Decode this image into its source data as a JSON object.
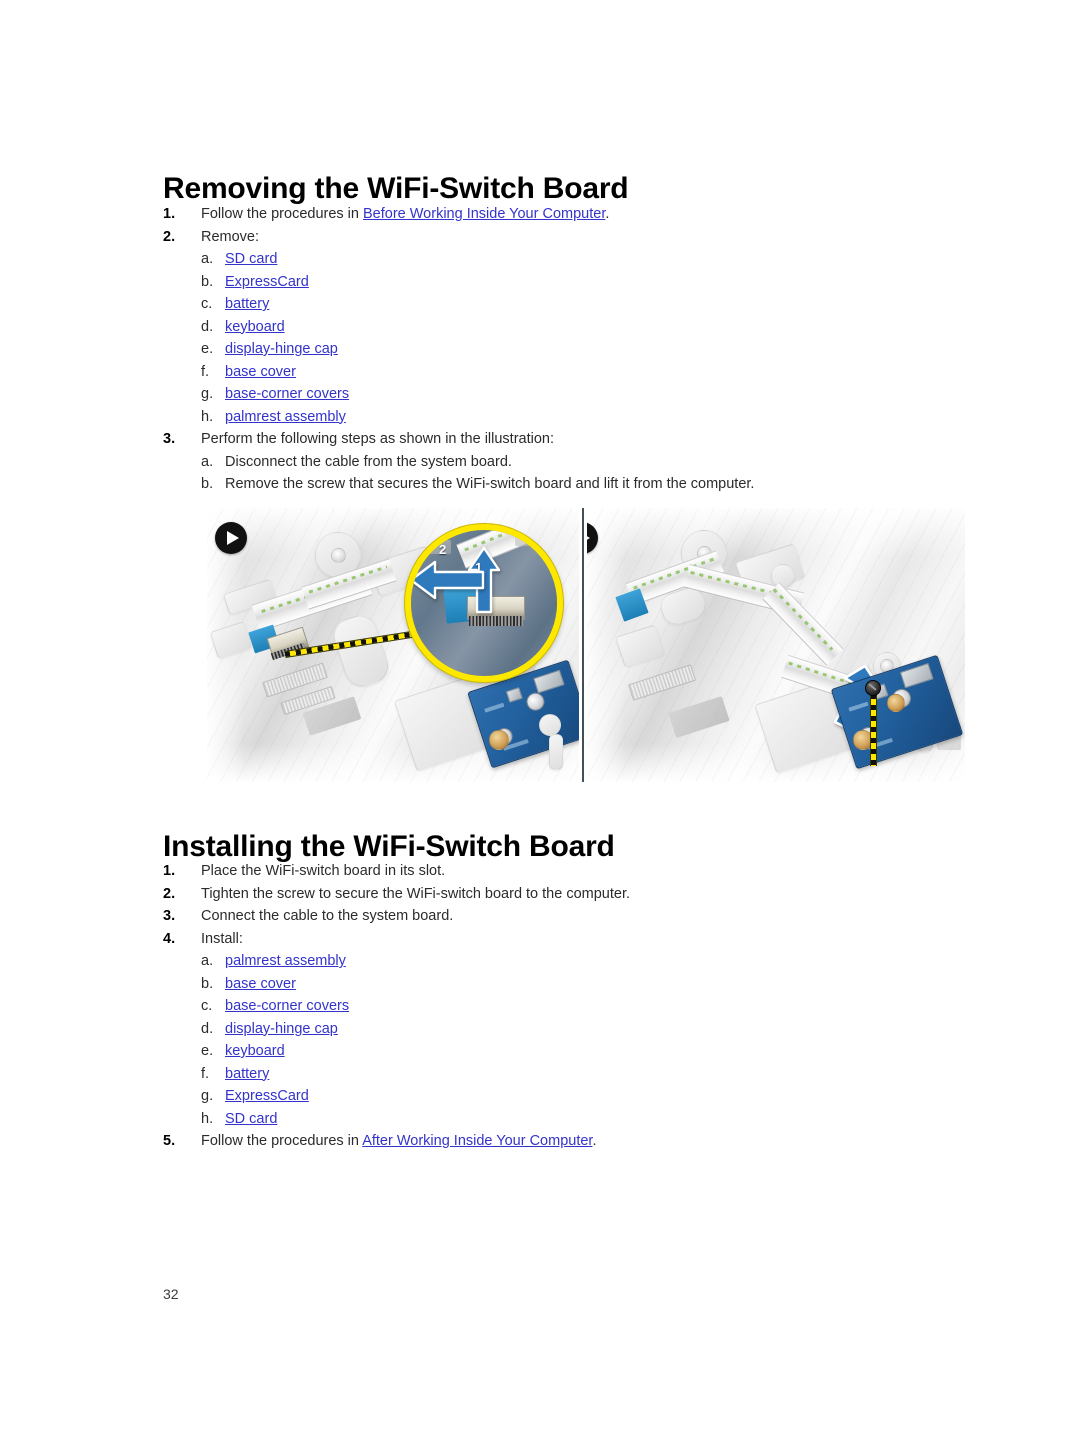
{
  "document": {
    "page_number": "32"
  },
  "removing": {
    "heading": "Removing the WiFi-Switch Board",
    "steps": [
      {
        "marker": "1.",
        "text_before": "Follow the procedures in ",
        "link": "Before Working Inside Your Computer",
        "text_after": "."
      },
      {
        "marker": "2.",
        "text": "Remove:"
      },
      {
        "marker": "3.",
        "text": "Perform the following steps as shown in the illustration:"
      }
    ],
    "remove_items": [
      {
        "marker": "a.",
        "label": "SD card",
        "is_link": true
      },
      {
        "marker": "b.",
        "label": "ExpressCard",
        "is_link": true
      },
      {
        "marker": "c.",
        "label": "battery",
        "is_link": true
      },
      {
        "marker": "d.",
        "label": "keyboard",
        "is_link": true
      },
      {
        "marker": "e.",
        "label": "display-hinge cap",
        "is_link": true
      },
      {
        "marker": "f.",
        "label": "base cover",
        "is_link": true
      },
      {
        "marker": "g.",
        "label": "base-corner covers",
        "is_link": true
      },
      {
        "marker": "h.",
        "label": "palmrest assembly",
        "is_link": true
      }
    ],
    "illustration_steps": [
      {
        "marker": "a.",
        "label": "Disconnect the cable from the system board.",
        "is_link": false
      },
      {
        "marker": "b.",
        "label": "Remove the screw that secures the WiFi-switch board and lift it from the computer.",
        "is_link": false
      }
    ]
  },
  "installing": {
    "heading": "Installing the WiFi-Switch Board",
    "steps": [
      {
        "marker": "1.",
        "text": "Place the WiFi-switch board in its slot."
      },
      {
        "marker": "2.",
        "text": "Tighten the screw to secure the WiFi-switch board to the computer."
      },
      {
        "marker": "3.",
        "text": "Connect the cable to the system board."
      },
      {
        "marker": "4.",
        "text": "Install:"
      }
    ],
    "install_items": [
      {
        "marker": "a.",
        "label": "palmrest assembly",
        "is_link": true
      },
      {
        "marker": "b.",
        "label": "base cover",
        "is_link": true
      },
      {
        "marker": "c.",
        "label": "base-corner covers",
        "is_link": true
      },
      {
        "marker": "d.",
        "label": "display-hinge cap",
        "is_link": true
      },
      {
        "marker": "e.",
        "label": "keyboard",
        "is_link": true
      },
      {
        "marker": "f.",
        "label": "battery",
        "is_link": true
      },
      {
        "marker": "g.",
        "label": "ExpressCard",
        "is_link": true
      },
      {
        "marker": "h.",
        "label": "SD card",
        "is_link": true
      }
    ],
    "final_step": {
      "marker": "5.",
      "text_before": "Follow the procedures in ",
      "link": "After Working Inside Your Computer",
      "text_after": "."
    }
  },
  "figure": {
    "panel_left": {
      "badge": "play-badge",
      "magnifier_labels": [
        "1",
        "2"
      ],
      "description": "Laptop chassis with WiFi-switch cable and magnified connector detail"
    },
    "panel_right": {
      "badge": "play-badge",
      "description": "WiFi-switch board being lifted out with its securing screw"
    }
  },
  "colors": {
    "link": "#3333cc",
    "heading": "#000000",
    "body_text": "#2b2b2b",
    "magnifier_ring": "#ffe800",
    "arrow": "#2a6fb0",
    "pcb": "#215f9d"
  }
}
